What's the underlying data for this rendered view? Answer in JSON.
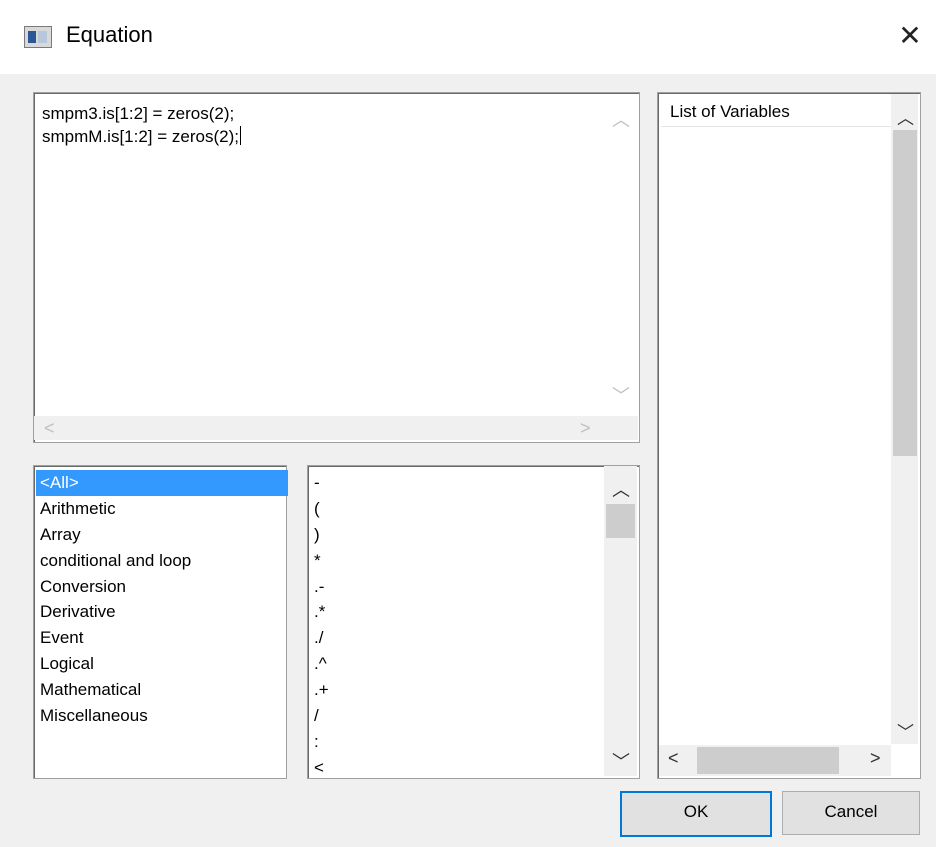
{
  "window": {
    "title": "Equation",
    "close_glyph": "✕",
    "icon": "window-app-icon"
  },
  "editor": {
    "lines": [
      "smpm3.is[1:2] = zeros(2);",
      "smpmM.is[1:2] = zeros(2);"
    ]
  },
  "categories": {
    "items": [
      "<All>",
      "Arithmetic",
      "Array",
      "conditional and loop",
      "Conversion",
      "Derivative",
      "Event",
      "Logical",
      "Mathematical",
      "Miscellaneous"
    ],
    "selected": "<All>"
  },
  "operators": {
    "items": [
      "-",
      "(",
      ")",
      "*",
      ".-",
      ".*",
      "./",
      ".^",
      ".+",
      "/",
      ":",
      "<"
    ]
  },
  "variables": {
    "header": "List of Variables",
    "items": []
  },
  "buttons": {
    "ok_label": "OK",
    "cancel_label": "Cancel"
  },
  "colors": {
    "selection": "#3399ff",
    "default_button_border": "#0078d7"
  }
}
